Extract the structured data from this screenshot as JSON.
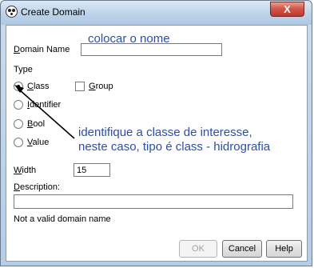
{
  "window": {
    "title": "Create Domain",
    "close_label": "X"
  },
  "form": {
    "domain_name_label": "Domain Name",
    "domain_name_value": "",
    "type_label": "Type",
    "types": [
      {
        "label": "Class",
        "checked": true
      },
      {
        "label": "Identifier",
        "checked": false
      },
      {
        "label": "Bool",
        "checked": false
      },
      {
        "label": "Value",
        "checked": false
      }
    ],
    "group_label": "Group",
    "group_checked": false,
    "width_label": "Width",
    "width_value": "15",
    "description_label": "Description:",
    "description_value": "",
    "status_message": "Not a valid domain name"
  },
  "buttons": {
    "ok": "OK",
    "cancel": "Cancel",
    "help": "Help"
  },
  "annotations": {
    "name_hint": "colocar o nome",
    "class_hint_line1": "identifique a classe de interesse,",
    "class_hint_line2": "neste caso, tipo é class - hidrografia",
    "color": "#2a4fb0"
  }
}
